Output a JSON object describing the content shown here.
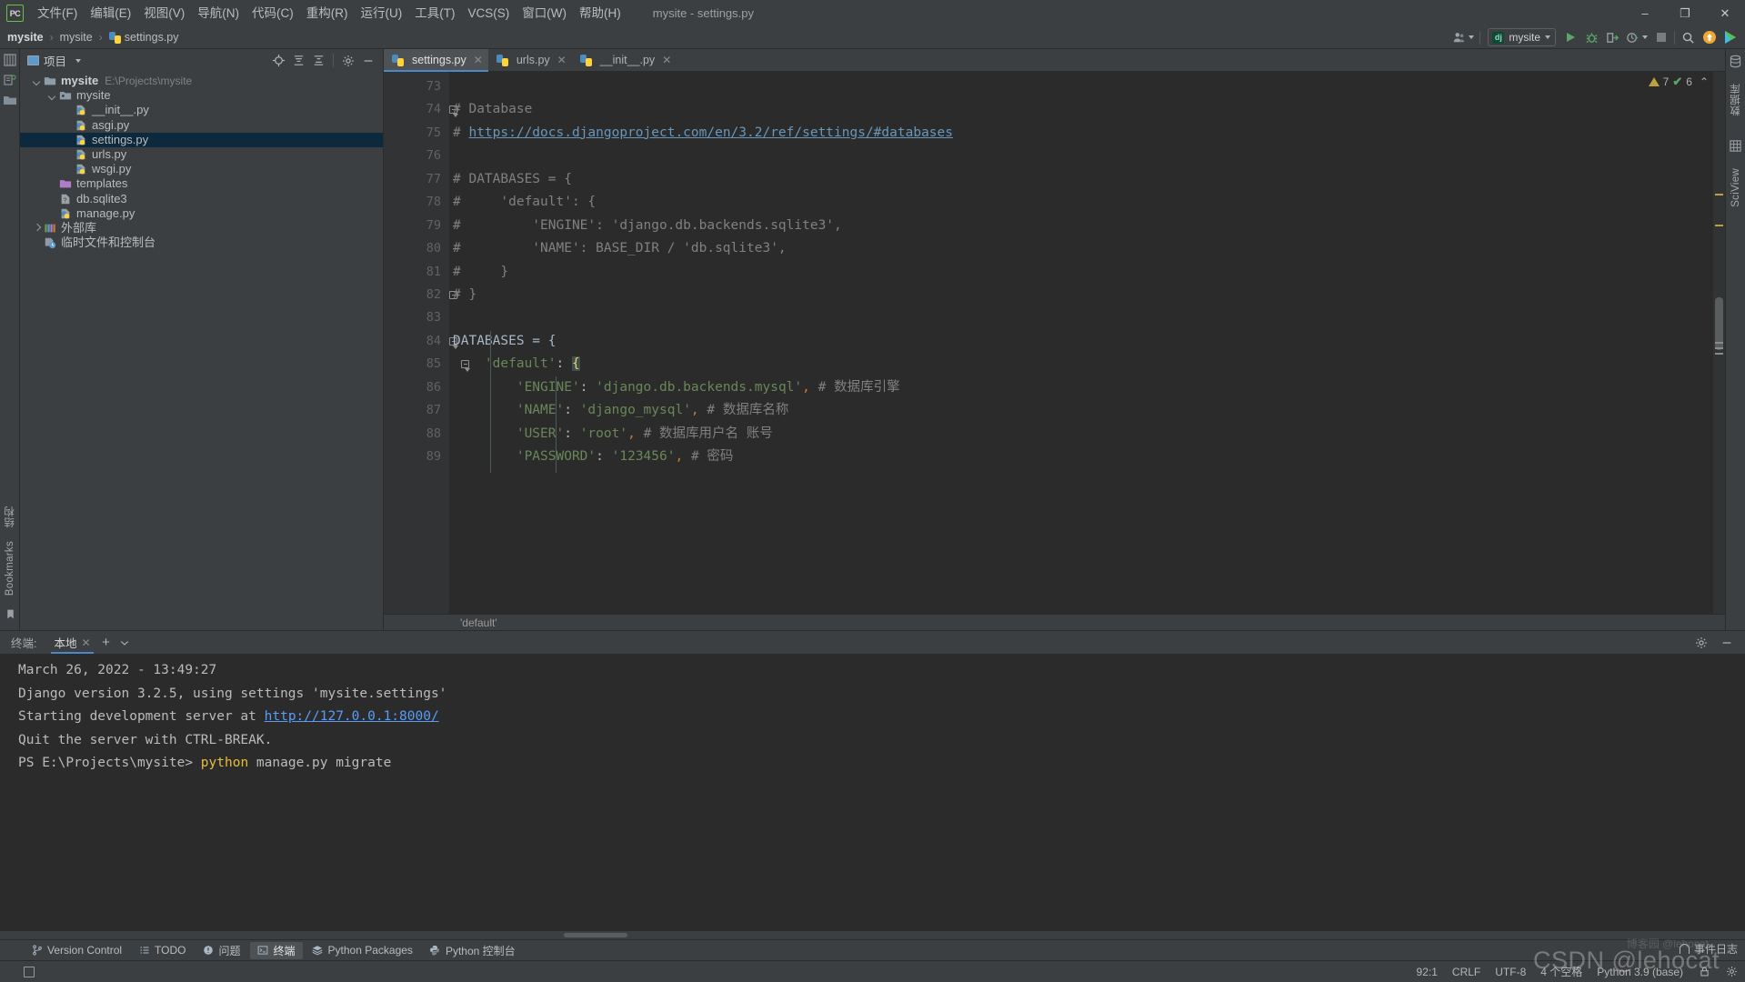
{
  "window": {
    "title": "mysite - settings.py",
    "logo_text": "PC",
    "controls": {
      "minimize": "–",
      "maximize": "❐",
      "close": "✕"
    }
  },
  "menu": {
    "items": [
      {
        "label": "文件(F)"
      },
      {
        "label": "编辑(E)"
      },
      {
        "label": "视图(V)"
      },
      {
        "label": "导航(N)"
      },
      {
        "label": "代码(C)"
      },
      {
        "label": "重构(R)"
      },
      {
        "label": "运行(U)"
      },
      {
        "label": "工具(T)"
      },
      {
        "label": "VCS(S)"
      },
      {
        "label": "窗口(W)"
      },
      {
        "label": "帮助(H)"
      }
    ]
  },
  "breadcrumb": {
    "root": "mysite",
    "package": "mysite",
    "file": "settings.py",
    "separator": "›"
  },
  "toolbar": {
    "user_icon": "user-icon",
    "run_config": {
      "label": "mysite",
      "icon_text": "dj"
    },
    "run": "run-button",
    "debug": "debug-button",
    "coverage": "coverage-button",
    "profile": "profile-button",
    "stop": "stop-button",
    "search": "🔍",
    "update": "update-button",
    "play_big": "play-button"
  },
  "left_rail": {
    "bottom_labels": [
      "结构",
      "Bookmarks"
    ]
  },
  "right_rail": {
    "labels": [
      "数据库",
      "SciView"
    ]
  },
  "project": {
    "panel_title": "项目",
    "tree": [
      {
        "indent": 0,
        "arrow": "down",
        "icon": "folder",
        "label": "mysite",
        "bold": true,
        "path": "E:\\Projects\\mysite",
        "selected": false
      },
      {
        "indent": 1,
        "arrow": "down",
        "icon": "package",
        "label": "mysite",
        "bold": false,
        "path": "",
        "selected": false
      },
      {
        "indent": 2,
        "arrow": "none",
        "icon": "python",
        "label": "__init__.py",
        "bold": false,
        "path": "",
        "selected": false
      },
      {
        "indent": 2,
        "arrow": "none",
        "icon": "python",
        "label": "asgi.py",
        "bold": false,
        "path": "",
        "selected": false
      },
      {
        "indent": 2,
        "arrow": "none",
        "icon": "python",
        "label": "settings.py",
        "bold": false,
        "path": "",
        "selected": true
      },
      {
        "indent": 2,
        "arrow": "none",
        "icon": "python",
        "label": "urls.py",
        "bold": false,
        "path": "",
        "selected": false
      },
      {
        "indent": 2,
        "arrow": "none",
        "icon": "python",
        "label": "wsgi.py",
        "bold": false,
        "path": "",
        "selected": false
      },
      {
        "indent": 1,
        "arrow": "none",
        "icon": "folder-purple",
        "label": "templates",
        "bold": false,
        "path": "",
        "selected": false
      },
      {
        "indent": 1,
        "arrow": "none",
        "icon": "db",
        "label": "db.sqlite3",
        "bold": false,
        "path": "",
        "selected": false
      },
      {
        "indent": 1,
        "arrow": "none",
        "icon": "python",
        "label": "manage.py",
        "bold": false,
        "path": "",
        "selected": false
      },
      {
        "indent": 0,
        "arrow": "right",
        "icon": "lib",
        "label": "外部库",
        "bold": false,
        "path": "",
        "selected": false
      },
      {
        "indent": 0,
        "arrow": "none",
        "icon": "scratch",
        "label": "临时文件和控制台",
        "bold": false,
        "path": "",
        "selected": false
      }
    ]
  },
  "editor": {
    "tabs": [
      {
        "label": "settings.py",
        "active": true
      },
      {
        "label": "urls.py",
        "active": false
      },
      {
        "label": "__init__.py",
        "active": false
      }
    ],
    "inspections": {
      "warnings": "7",
      "checks": "6",
      "collapse": "⌃"
    },
    "first_line_number": 73,
    "breadcrumb": "'default'",
    "lines": [
      {
        "n": 73,
        "fold": "",
        "html": ""
      },
      {
        "n": 74,
        "fold": "arrow-dn",
        "html": "<span class=\"cmt\"># Database</span>"
      },
      {
        "n": 75,
        "fold": "",
        "html": "<span class=\"cmt\"># </span><span class=\"lnk\">https://docs.djangoproject.com/en/3.2/ref/settings/#databases</span>"
      },
      {
        "n": 76,
        "fold": "",
        "html": ""
      },
      {
        "n": 77,
        "fold": "",
        "html": "<span class=\"cmt\"># DATABASES = {</span>"
      },
      {
        "n": 78,
        "fold": "",
        "html": "<span class=\"cmt\">#     'default': {</span>"
      },
      {
        "n": 79,
        "fold": "",
        "html": "<span class=\"cmt\">#         'ENGINE': 'django.db.backends.sqlite3',</span>"
      },
      {
        "n": 80,
        "fold": "",
        "html": "<span class=\"cmt\">#         'NAME': BASE_DIR / 'db.sqlite3',</span>"
      },
      {
        "n": 81,
        "fold": "",
        "html": "<span class=\"cmt\">#     }</span>"
      },
      {
        "n": 82,
        "fold": "box",
        "html": "<span class=\"cmt\"># }</span>"
      },
      {
        "n": 83,
        "fold": "",
        "html": ""
      },
      {
        "n": 84,
        "fold": "arrow-dn",
        "html": "<span class=\"brace\">DATABASES = {</span>"
      },
      {
        "n": 85,
        "fold": "arrow-dn2",
        "html": "    <span class=\"str\">'default'</span><span class=\"brace\">: </span><span class=\"brace-hl\">{</span>"
      },
      {
        "n": 86,
        "fold": "",
        "html": "        <span class=\"str\">'ENGINE'</span><span class=\"brace\">: </span><span class=\"str\">'django.db.backends.mysql'</span><span class=\"comma-sq\">,</span> <span class=\"cmt-cn\"># 数据库引擎</span>"
      },
      {
        "n": 87,
        "fold": "",
        "html": "        <span class=\"str\">'NAME'</span><span class=\"brace\">: </span><span class=\"str\">'django_mysql'</span><span class=\"comma-sq\">,</span> <span class=\"cmt-cn\"># 数据库名称</span>"
      },
      {
        "n": 88,
        "fold": "",
        "html": "        <span class=\"str\">'USER'</span><span class=\"brace\">: </span><span class=\"str\">'root'</span><span class=\"comma-sq\">,</span> <span class=\"cmt-cn\"># 数据库用户名 账号</span>"
      },
      {
        "n": 89,
        "fold": "",
        "html": "        <span class=\"str\">'PASSWORD'</span><span class=\"brace\">: </span><span class=\"str\">'123456'</span><span class=\"comma-sq\">,</span> <span class=\"cmt-cn\"># 密码</span>"
      }
    ]
  },
  "terminal": {
    "label": "终端:",
    "tab": "本地",
    "add": "+",
    "chevron": "⌄",
    "settings_icon": "gear-icon",
    "hide_icon": "minimize-icon",
    "lines": [
      {
        "html": "March 26, 2022 - 13:49:27"
      },
      {
        "html": "Django version 3.2.5, using settings 'mysite.settings'"
      },
      {
        "html": "Starting development server at <span class=\"t-link\">http://127.0.0.1:8000/</span>"
      },
      {
        "html": "Quit the server with CTRL-BREAK."
      },
      {
        "html": "PS E:\\Projects\\mysite&gt; <span class=\"t-yellow\">python</span> manage.py migrate"
      }
    ]
  },
  "toolwindows": {
    "items": [
      {
        "label": "Version Control",
        "icon": "branch-icon",
        "active": false
      },
      {
        "label": "TODO",
        "icon": "list-icon",
        "active": false
      },
      {
        "label": "问题",
        "icon": "warning-icon",
        "active": false
      },
      {
        "label": "终端",
        "icon": "terminal-icon",
        "active": true
      },
      {
        "label": "Python Packages",
        "icon": "packages-icon",
        "active": false
      },
      {
        "label": "Python 控制台",
        "icon": "python-icon",
        "active": false
      }
    ]
  },
  "statusbar": {
    "caret": "92:1",
    "line_separator": "CRLF",
    "encoding": "UTF-8",
    "indent": "4 个空格",
    "interpreter": "Python 3.9 (base)",
    "event_log": "事件日志"
  },
  "watermark": {
    "main": "CSDN @lehocat",
    "sub": "博客园 @lehocat"
  }
}
